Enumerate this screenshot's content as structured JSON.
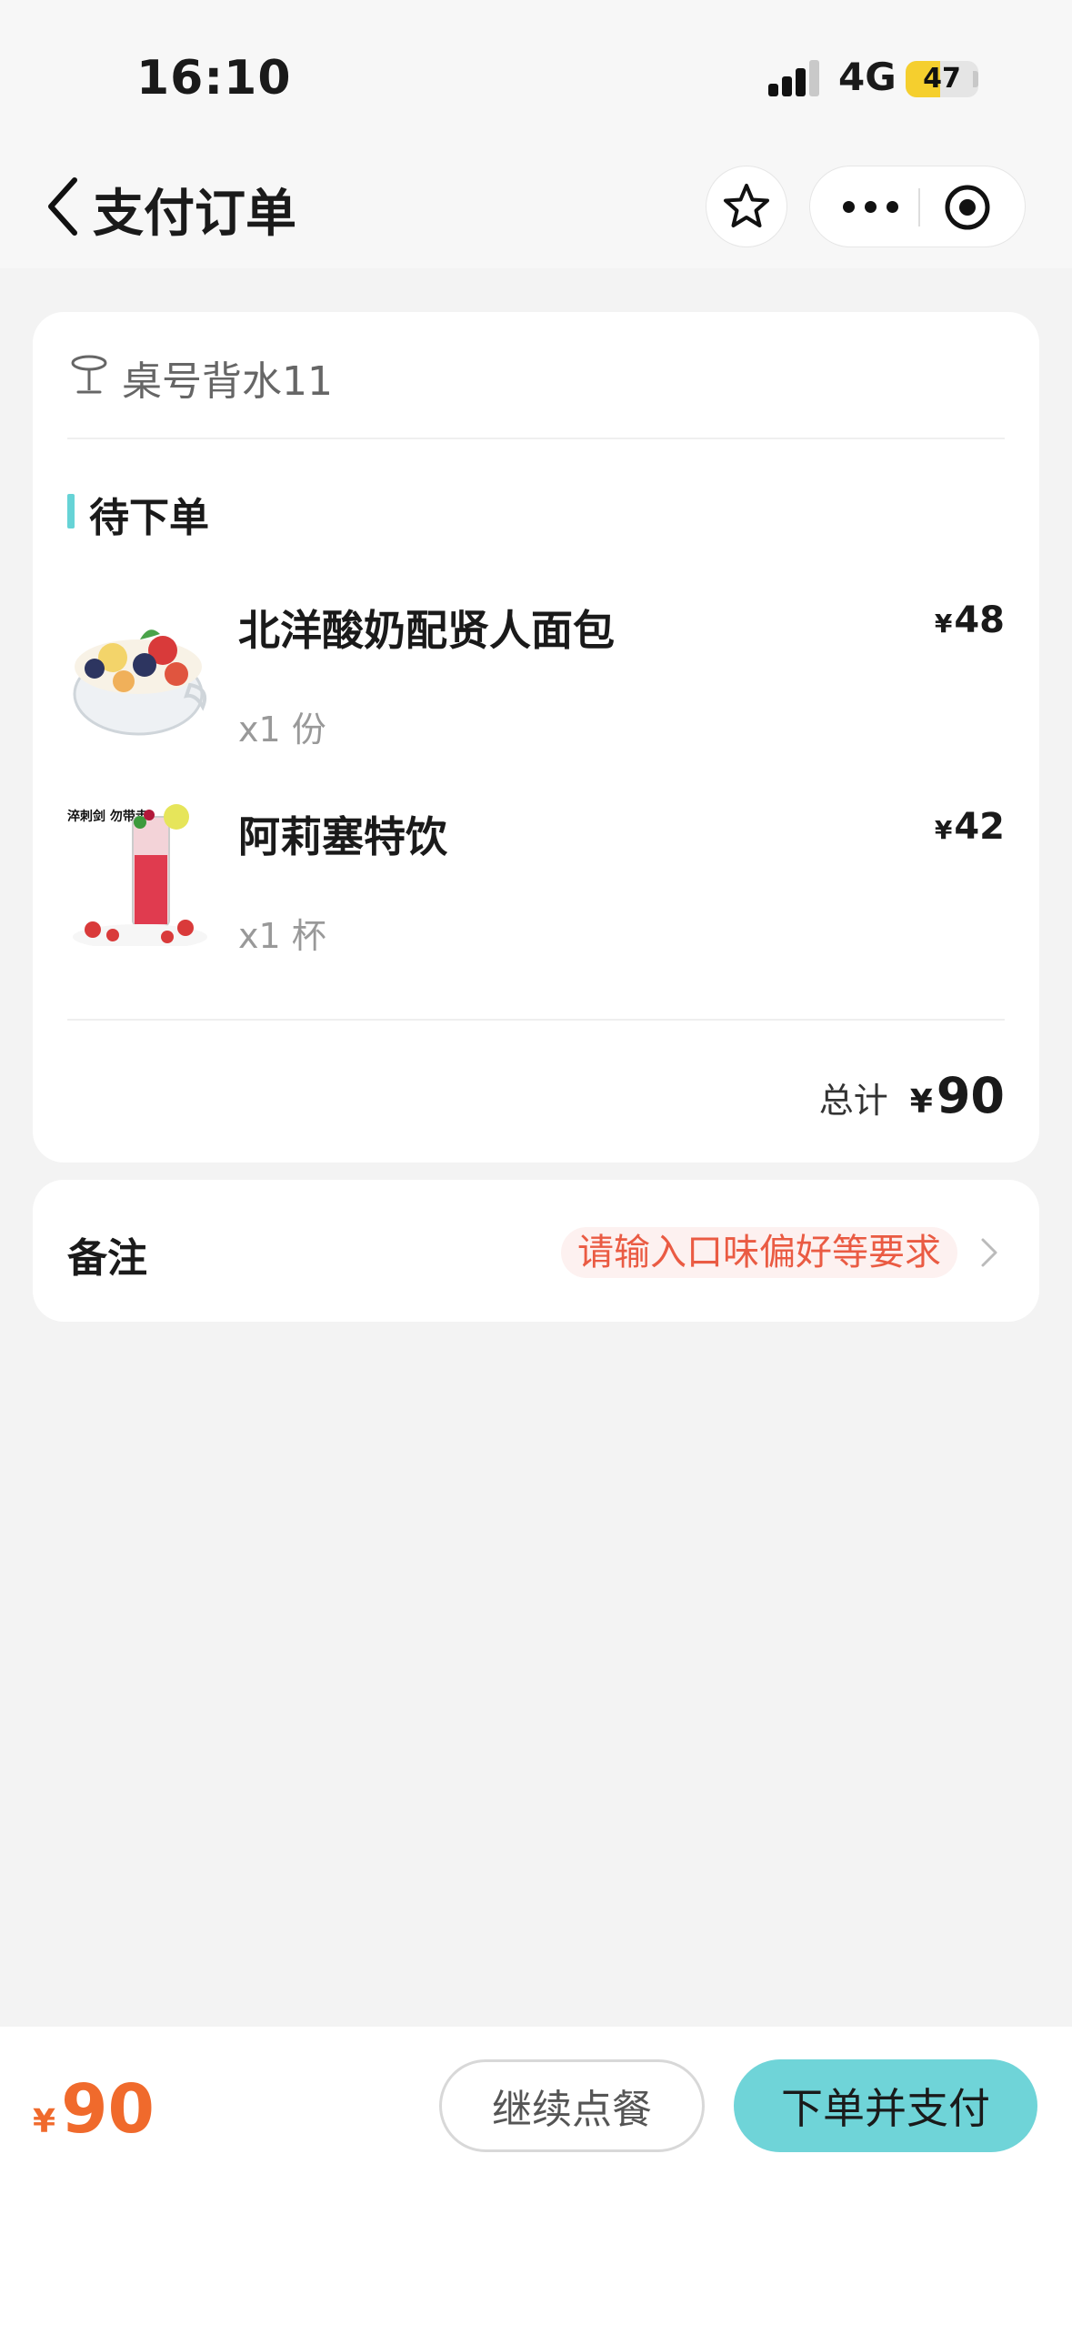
{
  "status_bar": {
    "time": "16:10",
    "network": "4G",
    "battery": "47",
    "battery_level": 0.47
  },
  "header": {
    "title": "支付订单",
    "back_icon": "chevron-left-icon",
    "favorite_icon": "star-icon",
    "more_icon": "more-dots-icon",
    "close_icon": "target-icon"
  },
  "order": {
    "table_label": "桌号背水11",
    "section_title": "待下单",
    "currency": "¥",
    "items": [
      {
        "name": "北洋酸奶配贤人面包",
        "quantity": "x1 份",
        "price": "48"
      },
      {
        "name": "阿莉塞特饮",
        "quantity": "x1 杯",
        "price": "42",
        "image_text": "淬刺剑 勿带走"
      }
    ],
    "total_label": "总计",
    "total": "90"
  },
  "remark": {
    "label": "备注",
    "placeholder": "请输入口味偏好等要求"
  },
  "bottom_bar": {
    "currency": "¥",
    "total": "90",
    "continue_label": "继续点餐",
    "submit_label": "下单并支付"
  },
  "colors": {
    "accent": "#6fd4d8",
    "price_orange": "#f06a2c",
    "hint_red": "#ea5b43"
  }
}
